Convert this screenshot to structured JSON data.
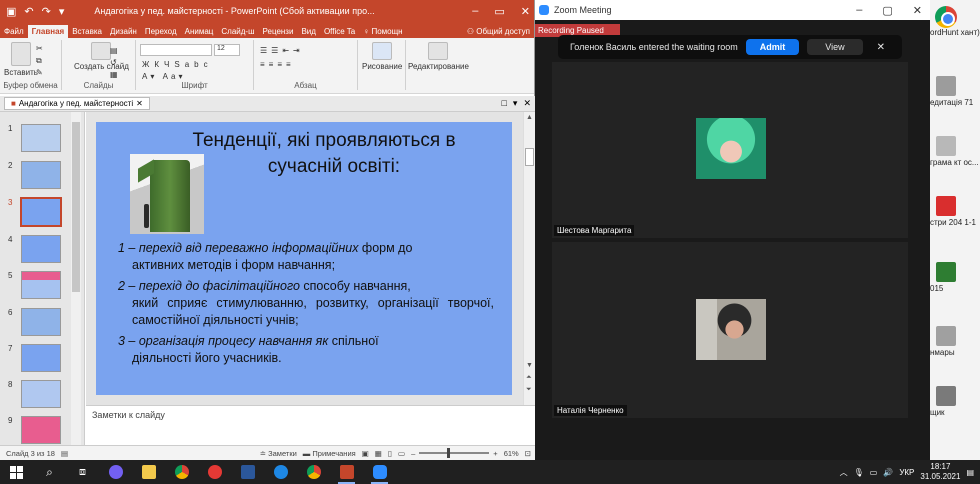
{
  "powerpoint": {
    "title": "Андагогіка у пед. майстерності - PowerPoint (Сбой активации про...",
    "tabs": [
      "Файл",
      "Главная",
      "Вставка",
      "Дизайн",
      "Переход",
      "Анимац",
      "Слайд-ш",
      "Рецензи",
      "Вид",
      "Office Ta"
    ],
    "active_tab": "Главная",
    "help": "Помощн",
    "share": "Общий доступ",
    "ribbon": {
      "paste": "Вставить",
      "new_slide": "Создать слайд",
      "font_size": "12",
      "drawing": "Рисование",
      "editing": "Редактирование",
      "groups": {
        "clipboard": "Буфер обмена",
        "slides": "Слайды",
        "font": "Шрифт",
        "paragraph": "Абзац"
      }
    },
    "document_tab": "Андагогіка у пед. майстерності",
    "thumbnails": [
      {
        "num": "1",
        "color": "#b9cfee"
      },
      {
        "num": "2",
        "color": "#8fb3e8"
      },
      {
        "num": "3",
        "color": "#7aa3ef"
      },
      {
        "num": "4",
        "color": "#7aa3ef"
      },
      {
        "num": "5",
        "color": "#a6c2f0"
      },
      {
        "num": "6",
        "color": "#8fb3e8"
      },
      {
        "num": "7",
        "color": "#7aa3ef"
      },
      {
        "num": "8",
        "color": "#b0c8f0"
      },
      {
        "num": "9",
        "color": "#e85d8f"
      }
    ],
    "selected_slide": "3",
    "slide": {
      "title_line1": "Тенденції, які проявляються в",
      "title_line2": "сучасній освіті:",
      "p1_italic": "1 – перехід від переважно інформаційних",
      "p1_rest": " форм до",
      "p1_line2": "активних методів і форм навчання;",
      "p2_italic": "2 – перехід до фасілітаційного",
      "p2_rest": " способу навчання,",
      "p2_line2": "який сприяє стимулюванню, розвитку, організації творчої, самостійної діяльності учнів;",
      "p3_italic": "3    – організація процесу навчання як",
      "p3_rest": " спільної",
      "p3_line2": "діяльності його учасників."
    },
    "notes_placeholder": "Заметки к слайду",
    "status": {
      "slide_counter": "Слайд 3 из 18",
      "notes": "Заметки",
      "comments": "Примечания",
      "zoom": "61%"
    }
  },
  "zoom": {
    "title": "Zoom Meeting",
    "recording": "Recording Paused",
    "notice": "Голенок Василь entered the waiting room",
    "admit": "Admit",
    "view": "View",
    "participants": [
      {
        "name": "Шестова Маргарита"
      },
      {
        "name": "Наталія Черненко"
      }
    ]
  },
  "desktop_icons": [
    {
      "label": "ordHunt хант)",
      "color": "#d23a3a"
    },
    {
      "label": "едитація 71",
      "color": "#9c9c9c"
    },
    {
      "label": "грама кт ос...",
      "color": "#9c9c9c"
    },
    {
      "label": "стри 204 1-1",
      "color": "#d92e2e"
    },
    {
      "label": "015",
      "color": "#2e7d32"
    },
    {
      "label": "нмары",
      "color": "#9c9c9c"
    },
    {
      "label": "щик",
      "color": "#7a7a7a"
    }
  ],
  "taskbar": {
    "lang": "УКР",
    "time": "18:17",
    "date": "31.05.2021"
  }
}
